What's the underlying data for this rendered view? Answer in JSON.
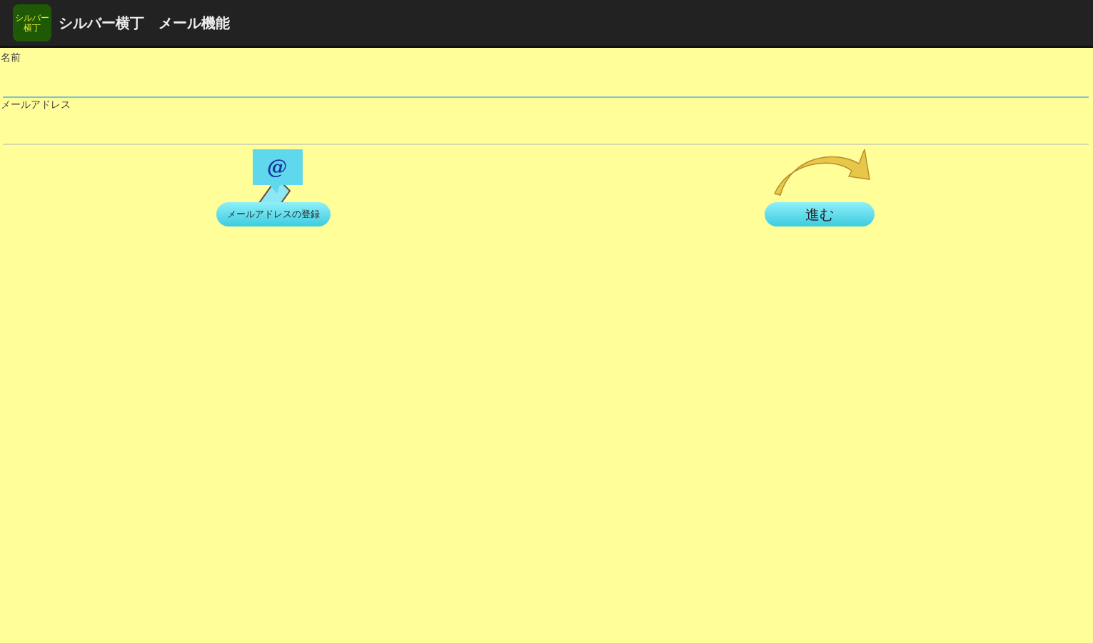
{
  "app_bar": {
    "logo": [
      "シルバー",
      "横丁"
    ],
    "title": "シルバー横丁　メール機能"
  },
  "fields": [
    {
      "label": "名前",
      "focused": true
    },
    {
      "label": "メールアドレス",
      "focused": false
    }
  ],
  "buttons": [
    {
      "kind": "register",
      "label": "メールアドレスの登録",
      "icon_text": "@"
    },
    {
      "kind": "next",
      "label": "進む"
    }
  ]
}
